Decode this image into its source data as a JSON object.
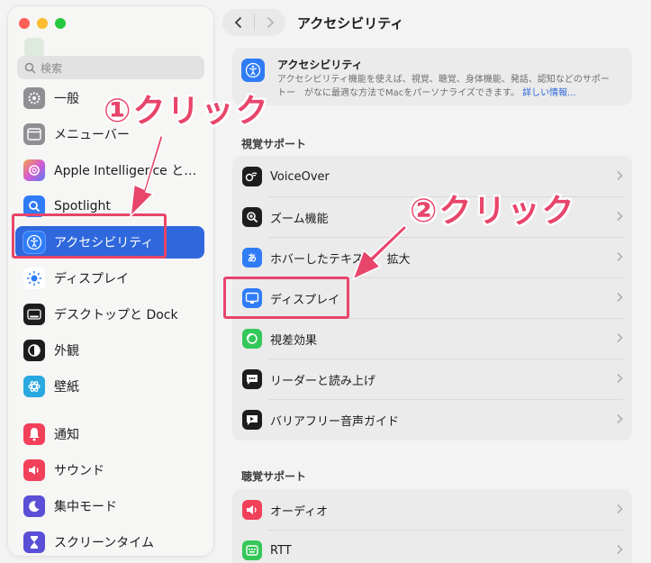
{
  "window": {
    "title": "アクセシビリティ"
  },
  "sidebar": {
    "search_placeholder": "検索",
    "items": [
      {
        "label": "一般",
        "icon": "gear-icon",
        "color": "#8e8e93"
      },
      {
        "label": "メニューバー",
        "icon": "menubar-icon",
        "color": "#8e8e93"
      },
      {
        "label": "Apple Intelligence とSiri",
        "icon": "apple-intelligence-icon",
        "color": "#c86bd6"
      },
      {
        "label": "Spotlight",
        "icon": "magnifier-icon",
        "color": "#2f7cf6"
      },
      {
        "label": "アクセシビリティ",
        "icon": "accessibility-icon",
        "color": "#2f7cf6",
        "selected": true
      },
      {
        "label": "ディスプレイ",
        "icon": "sun-icon",
        "color": "#2f7cf6"
      },
      {
        "label": "デスクトップと Dock",
        "icon": "dock-icon",
        "color": "#1d1d1f"
      },
      {
        "label": "外観",
        "icon": "appearance-icon",
        "color": "#1d1d1f"
      },
      {
        "label": "壁紙",
        "icon": "wallpaper-icon",
        "color": "#2aa8e0"
      },
      {
        "label": "通知",
        "icon": "bell-icon",
        "color": "#f2405a"
      },
      {
        "label": "サウンド",
        "icon": "speaker-icon",
        "color": "#f2405a"
      },
      {
        "label": "集中モード",
        "icon": "moon-icon",
        "color": "#5a4fd6"
      },
      {
        "label": "スクリーンタイム",
        "icon": "hourglass-icon",
        "color": "#5a4fd6"
      }
    ]
  },
  "main": {
    "intro": {
      "title": "アクセシビリティ",
      "line1": "アクセシビリティ機能を使えば、視覚、聴覚、身体機能、発話、認知などのサポー",
      "line2": "トー　がなに最適な方法でMacをパーソナライズできます。",
      "link": "詳しい情報..."
    },
    "vision_section": "視覚サポート",
    "vision_rows": [
      {
        "label": "VoiceOver",
        "icon": "voiceover-icon"
      },
      {
        "label": "ズーム機能",
        "icon": "zoom-icon"
      },
      {
        "label": "ホバーしたテキスト　拡大",
        "icon": "hover-text-icon"
      },
      {
        "label": "ディスプレイ",
        "icon": "display-icon"
      },
      {
        "label": "視差効果",
        "icon": "motion-icon"
      },
      {
        "label": "リーダーと読み上げ",
        "icon": "reader-icon"
      },
      {
        "label": "バリアフリー音声ガイド",
        "icon": "audio-description-icon"
      }
    ],
    "hearing_section": "聴覚サポート",
    "hearing_rows": [
      {
        "label": "オーディオ",
        "icon": "audio-icon"
      },
      {
        "label": "RTT",
        "icon": "rtt-icon"
      }
    ]
  },
  "annotations": {
    "step1": "①クリック",
    "step2": "②クリック",
    "color": "#e8456b"
  }
}
